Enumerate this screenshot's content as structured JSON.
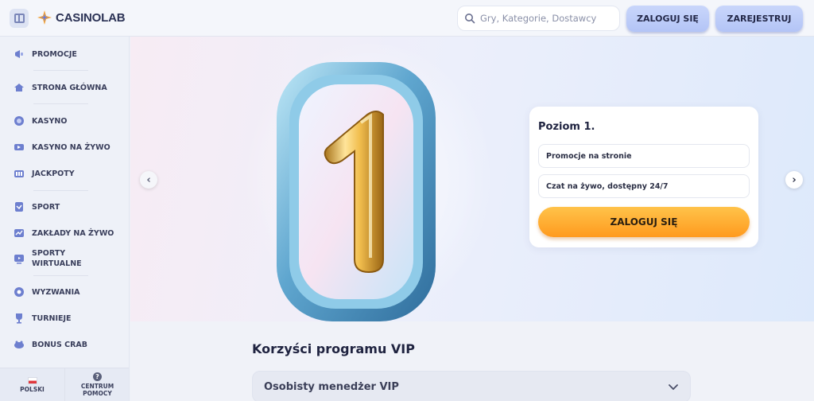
{
  "header": {
    "logo_text_a": "CASINO",
    "logo_text_b": "LAB",
    "search_placeholder": "Gry, Kategorie, Dostawcy",
    "login_label": "ZALOGUJ SIĘ",
    "register_label": "ZAREJESTRUJ"
  },
  "sidebar": {
    "items": [
      {
        "label": "PROMOCJE",
        "icon": "promo-megaphone-icon"
      },
      {
        "label": "STRONA GŁÓWNA",
        "icon": "home-icon"
      },
      {
        "label": "KASYNO",
        "icon": "casino-chip-icon"
      },
      {
        "label": "KASYNO NA ŻYWO",
        "icon": "live-casino-icon"
      },
      {
        "label": "JACKPOTY",
        "icon": "jackpot-icon"
      },
      {
        "label": "SPORT",
        "icon": "sport-icon"
      },
      {
        "label": "ZAKŁADY NA ŻYWO",
        "icon": "live-bets-icon"
      },
      {
        "label": "SPORTY WIRTUALNE",
        "icon": "virtual-sports-icon"
      },
      {
        "label": "WYZWANIA",
        "icon": "challenges-icon"
      },
      {
        "label": "TURNIEJE",
        "icon": "trophy-icon"
      },
      {
        "label": "BONUS CRAB",
        "icon": "bonus-crab-icon"
      }
    ],
    "footer": {
      "language_label": "POLSKI",
      "help_label": "CENTRUM POMOCY"
    }
  },
  "hero": {
    "level_title": "Poziom 1.",
    "perks": [
      "Promocje na stronie",
      "Czat na żywo, dostępny 24/7"
    ],
    "login_button": "ZALOGUJ SIĘ",
    "badge_number": "1"
  },
  "vip": {
    "title": "Korzyści programu VIP",
    "accordion_label": "Osobisty menedżer VIP"
  },
  "colors": {
    "accent_orange": "#ff9a1e",
    "header_button": "#b3c4f6",
    "text_dark": "#1f2340"
  }
}
